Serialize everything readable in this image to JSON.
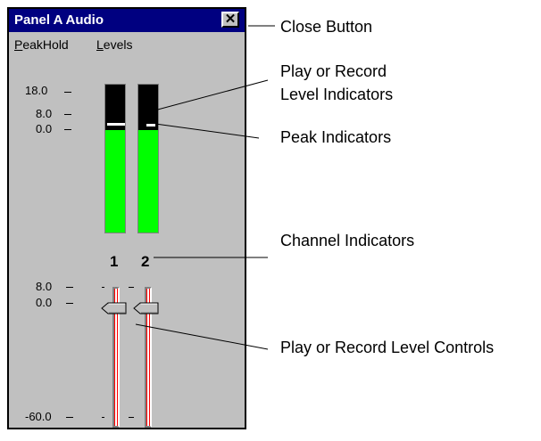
{
  "window": {
    "title": "Panel A Audio",
    "close_glyph": "✕",
    "menu": [
      {
        "label": "PeakHold",
        "mnemonic": "P",
        "rest": "eakHold"
      },
      {
        "label": "Levels",
        "mnemonic": "L",
        "rest": "evels"
      }
    ]
  },
  "meter_scale": [
    "18.0",
    "8.0",
    "0.0"
  ],
  "meters": [
    {
      "channel": "1",
      "level_db": -0.5
    },
    {
      "channel": "2",
      "level_db": -0.5
    }
  ],
  "slider_scale": [
    "8.0",
    "0.0",
    "-60.0"
  ],
  "sliders": [
    {
      "channel": "1",
      "level_db": 0.0
    },
    {
      "channel": "2",
      "level_db": 0.0
    }
  ],
  "annotations": {
    "close": "Close Button",
    "level_indicators_1": "Play or Record",
    "level_indicators_2": "Level Indicators",
    "peak": "Peak Indicators",
    "channel": "Channel Indicators",
    "level_controls": "Play or Record Level Controls"
  },
  "colors": {
    "titlebar": "#000080",
    "meter_fill": "#00ff00",
    "meter_bg": "#000000",
    "slider_track": "#ff0000",
    "window_bg": "#c0c0c0"
  }
}
